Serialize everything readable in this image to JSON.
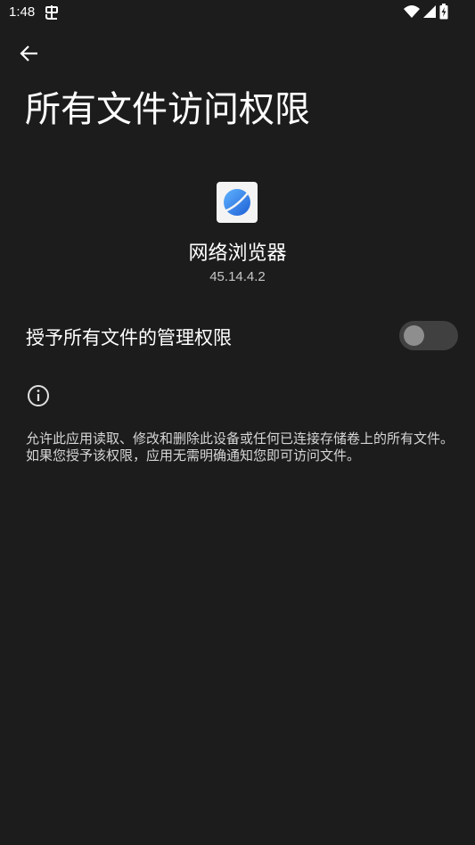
{
  "status_bar": {
    "time": "1:48",
    "icons": [
      "notification-app-icon",
      "wifi-icon",
      "cell-signal-icon",
      "battery-charging-icon"
    ]
  },
  "header": {
    "back_icon": "arrow-back-icon",
    "title": "所有文件访问权限"
  },
  "app": {
    "icon": "browser-app-icon",
    "name": "网络浏览器",
    "version": "45.14.4.2"
  },
  "permission": {
    "label": "授予所有文件的管理权限",
    "enabled": false
  },
  "info": {
    "icon": "info-icon",
    "text": "允许此应用读取、修改和删除此设备或任何已连接存储卷上的所有文件。如果您授予该权限，应用无需明确通知您即可访问文件。"
  },
  "colors": {
    "background": "#1c1c1c",
    "toggle_track": "#404040",
    "toggle_thumb": "#8e8e8e",
    "icon_blue": "#2d7de8"
  }
}
